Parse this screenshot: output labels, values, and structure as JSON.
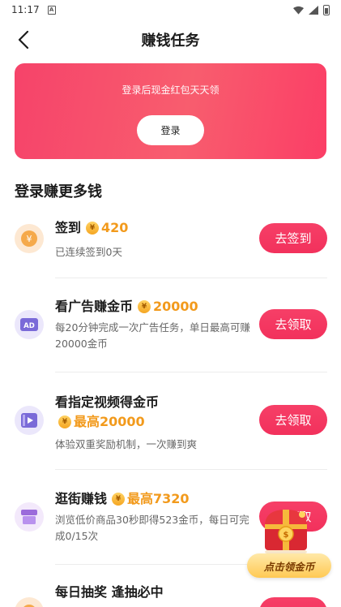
{
  "status_bar": {
    "time": "11:17",
    "sim_label": "A"
  },
  "header": {
    "title": "赚钱任务"
  },
  "banner": {
    "text": "登录后现金红包天天领",
    "login_label": "登录"
  },
  "section": {
    "title": "登录赚更多钱"
  },
  "tasks": [
    {
      "title": "签到",
      "reward": "420",
      "desc": "已连续签到0天",
      "button": "去签到",
      "icon": "yuan-coin-icon"
    },
    {
      "title": "看广告赚金币",
      "reward": "20000",
      "desc": "每20分钟完成一次广告任务，单日最高可赚20000金币",
      "button": "去领取",
      "icon": "ad-icon"
    },
    {
      "title": "看指定视频得金币",
      "reward": "最高20000",
      "desc": "体验双重奖励机制，一次赚到爽",
      "button": "去领取",
      "icon": "video-icon"
    },
    {
      "title": "逛街赚钱",
      "reward": "最高7320",
      "desc": "浏览低价商品30秒即得523金币，每日可完成0/15次",
      "button": "去领取",
      "icon": "shop-icon"
    },
    {
      "title": "每日抽奖 逢抽必中",
      "icon": "lottery-icon"
    }
  ],
  "float": {
    "label": "点击领金币",
    "icon": "treasure-chest-icon"
  },
  "colors": {
    "accent": "#f63f67",
    "reward": "#f29a1c",
    "banner_start": "#f6436a"
  }
}
